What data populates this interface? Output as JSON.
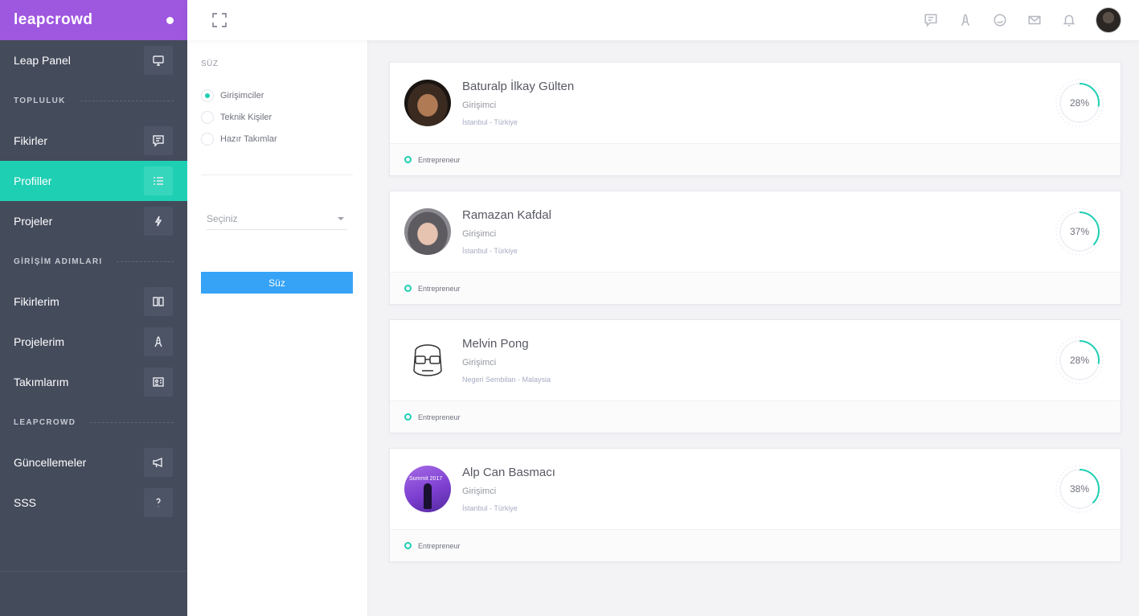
{
  "brand": {
    "logo": "leapcrowd"
  },
  "sidebar": {
    "items": [
      {
        "type": "item",
        "label": "Leap Panel",
        "icon": "monitor-icon",
        "active": false
      },
      {
        "type": "section",
        "label": "TOPLULUK"
      },
      {
        "type": "item",
        "label": "Fikirler",
        "icon": "comment-icon",
        "active": false
      },
      {
        "type": "item",
        "label": "Profiller",
        "icon": "list-icon",
        "active": true
      },
      {
        "type": "item",
        "label": "Projeler",
        "icon": "bolt-icon",
        "active": false
      },
      {
        "type": "section",
        "label": "GİRİŞİM ADIMLARI"
      },
      {
        "type": "item",
        "label": "Fikirlerim",
        "icon": "book-icon",
        "active": false
      },
      {
        "type": "item",
        "label": "Projelerim",
        "icon": "rocket-icon",
        "active": false
      },
      {
        "type": "item",
        "label": "Takımlarım",
        "icon": "id-card-icon",
        "active": false
      },
      {
        "type": "section",
        "label": "LEAPCROWD"
      },
      {
        "type": "item",
        "label": "Güncellemeler",
        "icon": "megaphone-icon",
        "active": false
      },
      {
        "type": "item",
        "label": "SSS",
        "icon": "question-icon",
        "active": false
      }
    ]
  },
  "topbar": {
    "icons": [
      "comment-icon",
      "rocket-icon",
      "chat-bubble-icon",
      "mail-icon",
      "bell-icon"
    ]
  },
  "filter": {
    "title": "SÜZ",
    "options": [
      {
        "label": "Girişimciler",
        "checked": true
      },
      {
        "label": "Teknik Kişiler",
        "checked": false
      },
      {
        "label": "Hazır Takımlar",
        "checked": false
      }
    ],
    "select_placeholder": "Seçiniz",
    "button_label": "Süz"
  },
  "colors": {
    "accent": "#1fcfb3",
    "brand": "#9e57df",
    "button": "#36a3f7",
    "sidebar": "#444b5b"
  },
  "profiles": [
    {
      "name": "Baturalp İlkay Gülten",
      "role": "Girişimci",
      "location": "İstanbul - Türkiye",
      "progress": 28,
      "progress_label": "28%",
      "tag": "Entrepreneur"
    },
    {
      "name": "Ramazan Kafdal",
      "role": "Girişimci",
      "location": "İstanbul - Türkiye",
      "progress": 37,
      "progress_label": "37%",
      "tag": "Entrepreneur"
    },
    {
      "name": "Melvin Pong",
      "role": "Girişimci",
      "location": "Negeri Sembilan - Malaysia",
      "progress": 28,
      "progress_label": "28%",
      "tag": "Entrepreneur"
    },
    {
      "name": "Alp Can Basmacı",
      "role": "Girişimci",
      "location": "İstanbul - Türkiye",
      "progress": 38,
      "progress_label": "38%",
      "tag": "Entrepreneur",
      "avatar_text": "Summit 2017"
    }
  ]
}
